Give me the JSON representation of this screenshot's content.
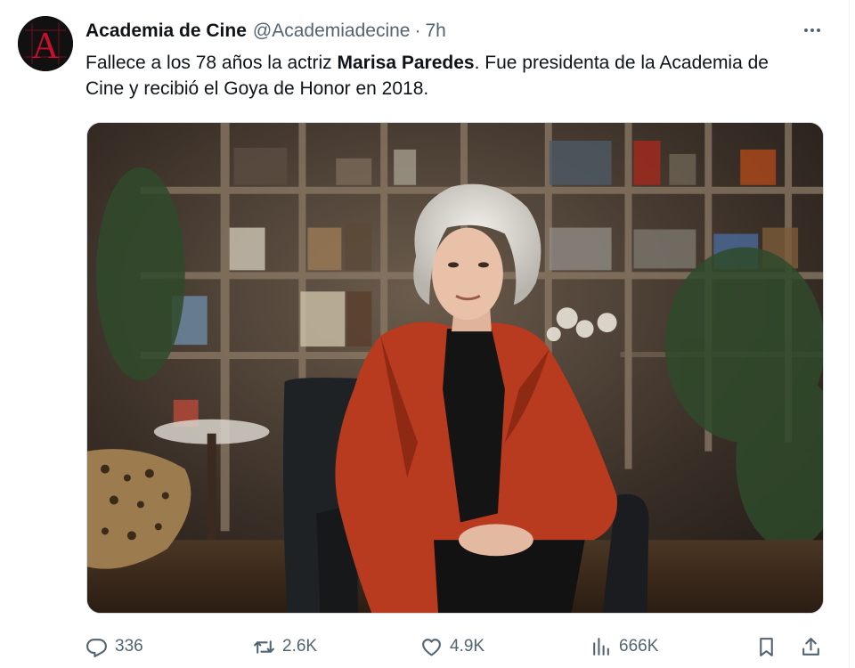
{
  "author": {
    "display_name": "Academia de Cine",
    "handle": "@Academiadecine",
    "separator": "·",
    "time": "7h",
    "avatar_letter": "A"
  },
  "tweet": {
    "text_before": "Fallece a los 78 años la actriz ",
    "text_bold": "Marisa Paredes",
    "text_after": ". Fue presidenta de la Academia de Cine y recibió el Goya de Honor en 2018."
  },
  "media": {
    "description_icon": "photo"
  },
  "actions": {
    "replies": "336",
    "retweets": "2.6K",
    "likes": "4.9K",
    "views": "666K"
  },
  "colors": {
    "text": "#0f1419",
    "secondary": "#536471",
    "avatar_red": "#c8102e"
  }
}
